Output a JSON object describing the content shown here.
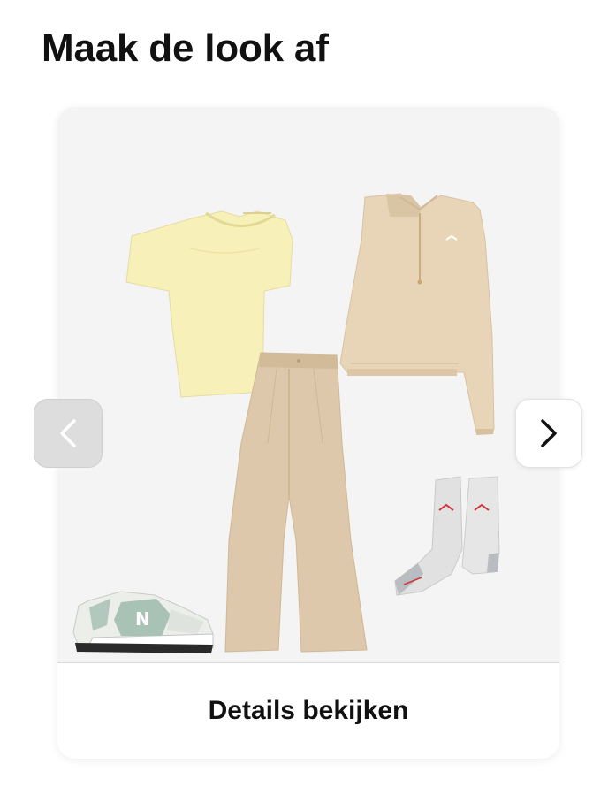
{
  "header": {
    "title": "Maak de look af"
  },
  "card": {
    "details_label": "Details bekijken",
    "items": [
      {
        "icon": "tshirt-icon",
        "color": "#f5eeb4"
      },
      {
        "icon": "sweatshirt-icon",
        "color": "#e6d2b3"
      },
      {
        "icon": "trousers-icon",
        "color": "#ddc8aa"
      },
      {
        "icon": "socks-icon",
        "color": "#dedede"
      },
      {
        "icon": "sneaker-icon",
        "color": "#e9ebe7"
      }
    ]
  },
  "carousel": {
    "prev_icon": "chevron-left-icon",
    "next_icon": "chevron-right-icon"
  },
  "colors": {
    "background": "#ffffff",
    "card_image_bg": "#f4f4f4",
    "text": "#111111",
    "brand_accent": "#d1343b"
  }
}
